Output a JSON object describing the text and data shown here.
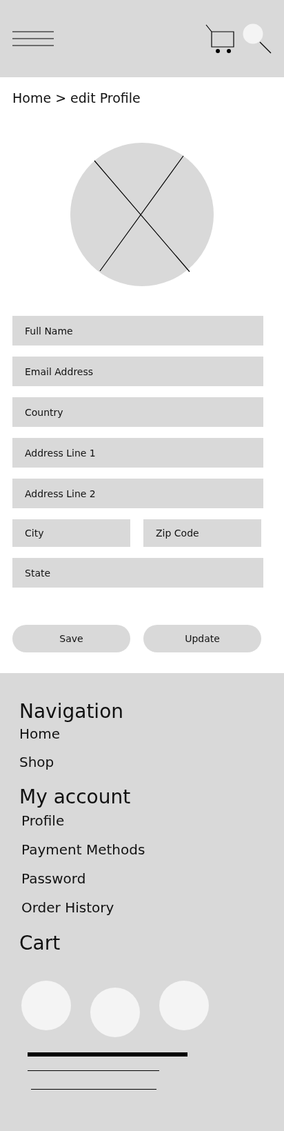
{
  "breadcrumb": "Home > edit Profile",
  "form": {
    "rows": [
      {
        "fields": [
          {
            "placeholder": "Full Name"
          }
        ]
      },
      {
        "fields": [
          {
            "placeholder": "Email Address"
          }
        ]
      },
      {
        "fields": [
          {
            "placeholder": "Country"
          }
        ]
      },
      {
        "fields": [
          {
            "placeholder": "Address Line 1"
          }
        ]
      },
      {
        "fields": [
          {
            "placeholder": "Address Line 2"
          }
        ]
      },
      {
        "fields": [
          {
            "placeholder": "City"
          },
          {
            "placeholder": "Zip Code"
          }
        ]
      },
      {
        "fields": [
          {
            "placeholder": "State"
          }
        ]
      }
    ],
    "buttons": [
      "Save",
      "Update"
    ]
  },
  "footer": {
    "sections": [
      {
        "title": "Navigation",
        "links": [
          "Home",
          "Shop"
        ]
      },
      {
        "title": "My account",
        "links": [
          "Profile",
          "Payment Methods",
          "Password",
          "Order History"
        ]
      },
      {
        "title": "Cart"
      }
    ]
  }
}
